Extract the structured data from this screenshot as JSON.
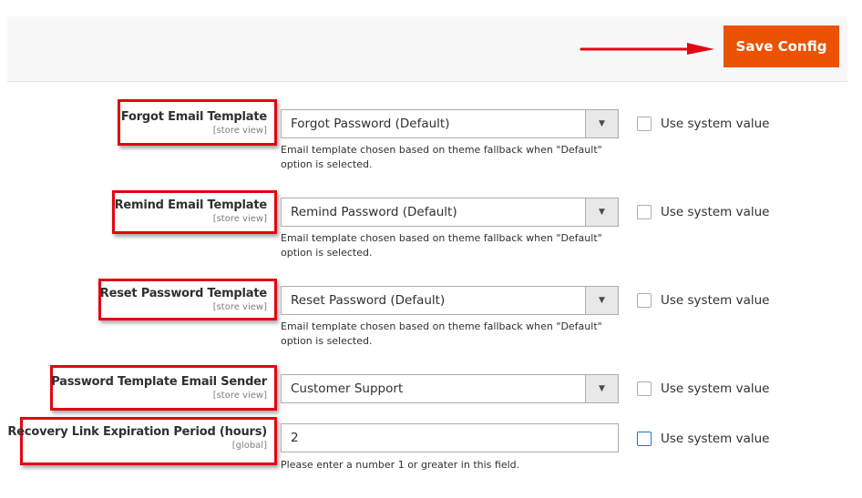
{
  "header": {
    "save_button_label": "Save Config",
    "accent_color": "#eb5202",
    "annotation_color": "#e30613"
  },
  "fields": [
    {
      "label": "Forgot Email Template",
      "scope": "[store view]",
      "type": "select",
      "value": "Forgot Password (Default)",
      "note": "Email template chosen based on theme fallback when \"Default\" option is selected.",
      "use_system_value_label": "Use system value",
      "use_system_value_checked": false
    },
    {
      "label": "Remind Email Template",
      "scope": "[store view]",
      "type": "select",
      "value": "Remind Password (Default)",
      "note": "Email template chosen based on theme fallback when \"Default\" option is selected.",
      "use_system_value_label": "Use system value",
      "use_system_value_checked": false
    },
    {
      "label": "Reset Password Template",
      "scope": "[store view]",
      "type": "select",
      "value": "Reset Password (Default)",
      "note": "Email template chosen based on theme fallback when \"Default\" option is selected.",
      "use_system_value_label": "Use system value",
      "use_system_value_checked": false
    },
    {
      "label": "Password Template Email Sender",
      "scope": "[store view]",
      "type": "select",
      "value": "Customer Support",
      "note": "",
      "use_system_value_label": "Use system value",
      "use_system_value_checked": false
    },
    {
      "label": "Recovery Link Expiration Period (hours)",
      "scope": "[global]",
      "type": "text",
      "value": "2",
      "note": "Please enter a number 1 or greater in this field.",
      "use_system_value_label": "Use system value",
      "use_system_value_checked": false
    }
  ]
}
